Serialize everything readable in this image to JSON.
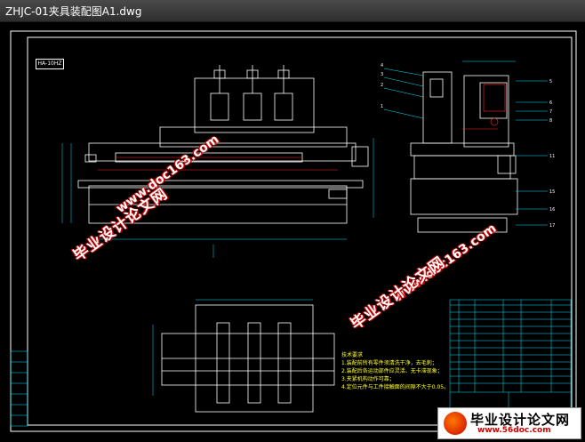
{
  "window": {
    "title": "ZHJC-01夹具装配图A1.dwg"
  },
  "drawing": {
    "label_box": "HA-10HZ",
    "tech_title": "技术要求",
    "tech_lines": [
      "1.装配前所有零件须清洗干净，去毛刺；",
      "2.装配后各运动部件应灵活、无卡滞现象；",
      "3.夹紧机构动作可靠；",
      "4.定位元件与工件接触面的间隙不大于0.05。"
    ]
  },
  "watermarks": {
    "cn": "毕业设计论文网",
    "en": "www.doc163.com"
  },
  "logo": {
    "cn": "毕业设计论文网",
    "en": "www.56doc.com"
  },
  "colors": {
    "drawing": "#ffffff",
    "dimension": "#00e5ff",
    "highlight": "#ff2a2a",
    "note": "#ffff33",
    "watermark_outline": "#cc0000"
  }
}
